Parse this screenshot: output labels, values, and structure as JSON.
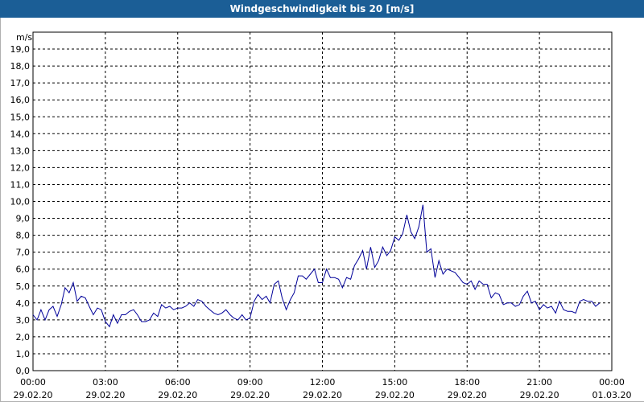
{
  "window": {
    "title": "Windgeschwindigkeit bis 20 [m/s]"
  },
  "chart_data": {
    "type": "line",
    "title": "Windgeschwindigkeit bis 20 [m/s]",
    "ylabel": "m/s",
    "xlabel": "",
    "ylim": [
      0,
      20
    ],
    "xlim_hours": [
      0,
      24
    ],
    "grid": true,
    "grid_style": "dashed",
    "line_color": "#000099",
    "y_ticks": [
      "0,0",
      "1,0",
      "2,0",
      "3,0",
      "4,0",
      "5,0",
      "6,0",
      "7,0",
      "8,0",
      "9,0",
      "10,0",
      "11,0",
      "12,0",
      "13,0",
      "14,0",
      "15,0",
      "16,0",
      "17,0",
      "18,0",
      "19,0"
    ],
    "x_ticks": [
      {
        "time": "00:00",
        "date": "29.02.20"
      },
      {
        "time": "03:00",
        "date": "29.02.20"
      },
      {
        "time": "06:00",
        "date": "29.02.20"
      },
      {
        "time": "09:00",
        "date": "29.02.20"
      },
      {
        "time": "12:00",
        "date": "29.02.20"
      },
      {
        "time": "15:00",
        "date": "29.02.20"
      },
      {
        "time": "18:00",
        "date": "29.02.20"
      },
      {
        "time": "21:00",
        "date": "29.02.20"
      },
      {
        "time": "00:00",
        "date": "01.03.20"
      }
    ],
    "series": [
      {
        "x_hours": [
          0.0,
          0.17,
          0.33,
          0.5,
          0.67,
          0.83,
          1.0,
          1.17,
          1.33,
          1.5,
          1.67,
          1.83,
          2.0,
          2.17,
          2.33,
          2.5,
          2.67,
          2.83,
          3.0,
          3.17,
          3.33,
          3.5,
          3.67,
          3.83,
          4.0,
          4.17,
          4.33,
          4.5,
          4.67,
          4.83,
          5.0,
          5.17,
          5.33,
          5.5,
          5.67,
          5.83,
          6.0,
          6.17,
          6.33,
          6.5,
          6.67,
          6.83,
          7.0,
          7.17,
          7.33,
          7.5,
          7.67,
          7.83,
          8.0,
          8.17,
          8.33,
          8.5,
          8.67,
          8.83,
          9.0,
          9.17,
          9.33,
          9.5,
          9.67,
          9.83,
          10.0,
          10.17,
          10.33,
          10.5,
          10.67,
          10.83,
          11.0,
          11.17,
          11.33,
          11.5,
          11.67,
          11.83,
          12.0,
          12.17,
          12.33,
          12.5,
          12.67,
          12.83,
          13.0,
          13.17,
          13.33,
          13.5,
          13.67,
          13.83,
          14.0,
          14.17,
          14.33,
          14.5,
          14.67,
          14.83,
          15.0,
          15.17,
          15.33,
          15.5,
          15.67,
          15.83,
          16.0,
          16.17,
          16.33,
          16.5,
          16.67,
          16.83,
          17.0,
          17.17,
          17.33,
          17.5,
          17.67,
          17.83,
          18.0,
          18.17,
          18.33,
          18.5,
          18.67,
          18.83,
          19.0,
          19.17,
          19.33,
          19.5,
          19.67,
          19.83,
          20.0,
          20.17,
          20.33,
          20.5,
          20.67,
          20.83,
          21.0,
          21.17,
          21.33,
          21.5,
          21.67,
          21.83,
          22.0,
          22.17,
          22.33,
          22.5,
          22.67,
          22.83,
          23.0,
          23.17,
          23.33,
          23.5,
          23.67,
          23.83,
          24.0
        ],
        "values": [
          3.3,
          3.0,
          3.6,
          3.0,
          3.6,
          3.8,
          3.2,
          3.9,
          4.9,
          4.6,
          5.2,
          4.1,
          4.4,
          4.3,
          3.8,
          3.3,
          3.7,
          3.6,
          2.9,
          2.6,
          3.3,
          2.8,
          3.3,
          3.3,
          3.5,
          3.6,
          3.3,
          2.9,
          2.9,
          3.0,
          3.4,
          3.2,
          3.9,
          3.7,
          3.8,
          3.6,
          3.7,
          3.7,
          3.8,
          4.0,
          3.8,
          4.2,
          4.1,
          3.8,
          3.6,
          3.4,
          3.3,
          3.4,
          3.6,
          3.3,
          3.1,
          3.0,
          3.3,
          3.0,
          3.1,
          4.1,
          4.5,
          4.2,
          4.4,
          4.0,
          5.1,
          5.3,
          4.3,
          3.6,
          4.2,
          4.6,
          5.6,
          5.6,
          5.4,
          5.7,
          6.0,
          5.2,
          5.2,
          6.0,
          5.5,
          5.5,
          5.4,
          4.9,
          5.5,
          5.4,
          6.2,
          6.6,
          7.1,
          6.0,
          7.3,
          6.1,
          6.5,
          7.3,
          6.8,
          7.1,
          7.9,
          7.7,
          8.1,
          9.2,
          8.2,
          7.8,
          8.5,
          9.8,
          7.0,
          7.2,
          5.5,
          6.5,
          5.7,
          6.0,
          5.9,
          5.8,
          5.5,
          5.2,
          5.1,
          5.3,
          4.8,
          5.3,
          5.1,
          5.1,
          4.3,
          4.6,
          4.5,
          3.9,
          4.0,
          4.0,
          3.8,
          3.9,
          4.4,
          4.7,
          4.0,
          4.1,
          3.6,
          3.9,
          3.7,
          3.8,
          3.4,
          4.1,
          3.6,
          3.5,
          3.5,
          3.4,
          4.1,
          4.2,
          4.1,
          4.1,
          3.8,
          4.0
        ]
      }
    ]
  }
}
